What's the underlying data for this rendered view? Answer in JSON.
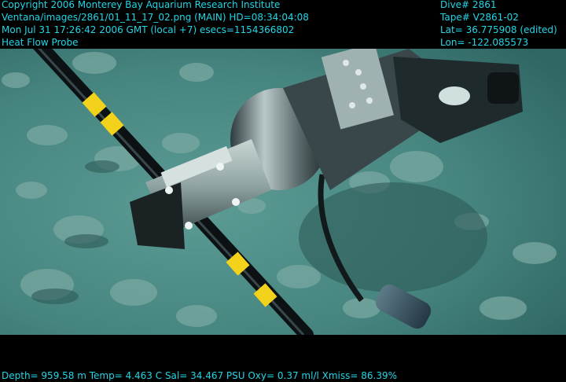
{
  "overlay": {
    "top_left": [
      "Copyright 2006 Monterey Bay Aquarium Research Institute",
      "Ventana/images/2861/01_11_17_02.png (MAIN)  HD=08:34:04:08",
      "Mon Jul 31 17:26:42 2006 GMT (local +7)  esecs=1154366802",
      "Heat Flow Probe"
    ],
    "top_right": [
      "Dive# 2861",
      "Tape# V2861-02",
      "Lat= 36.775908 (edited)",
      "Lon= -122.085573"
    ],
    "bottom": "Depth= 959.58 m  Temp= 4.463 C  Sal= 34.467 PSU  Oxy= 0.37 ml/l  Xmiss= 86.39%"
  },
  "colors": {
    "overlay_text": "#22d6e6",
    "seafloor": "#4a8a84",
    "probe_band": "#f2d21a"
  }
}
